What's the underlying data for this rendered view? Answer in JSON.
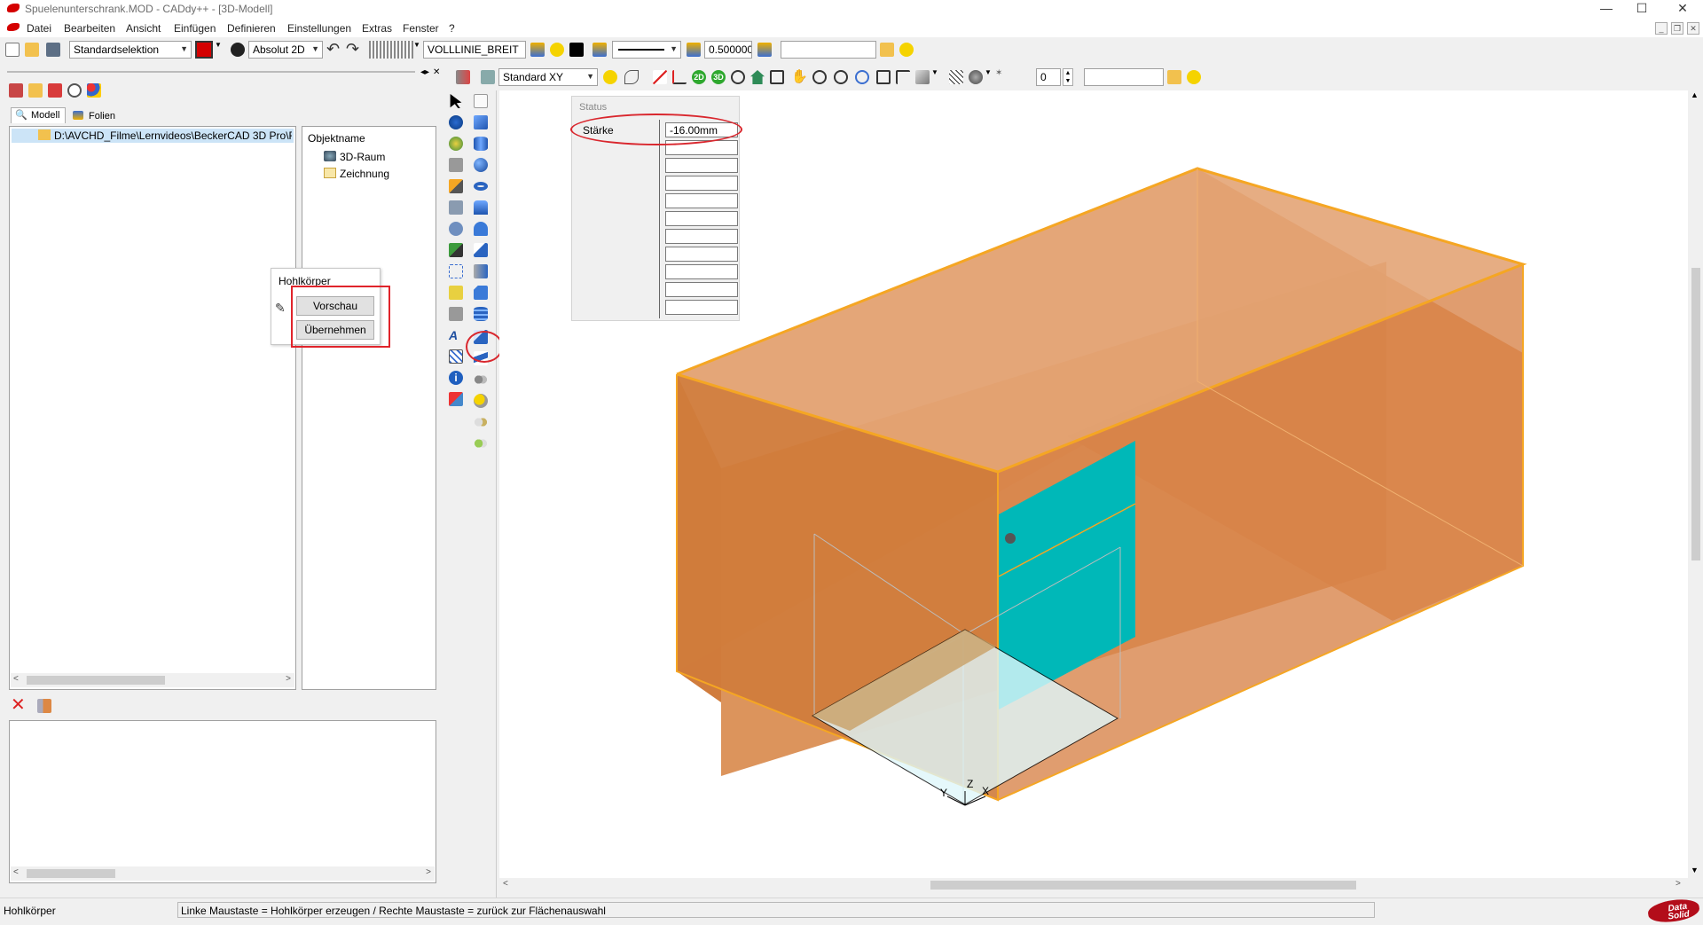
{
  "window": {
    "title": "Spuelenunterschrank.MOD  -  CADdy++ - [3D-Modell]",
    "controls": {
      "minimize": "—",
      "maximize": "☐",
      "close": "✕"
    }
  },
  "menu": [
    "Datei",
    "Bearbeiten",
    "Ansicht",
    "Einfügen",
    "Definieren",
    "Einstellungen",
    "Extras",
    "Fenster",
    "?"
  ],
  "toolbar": {
    "selection_mode": "Standardselektion",
    "coordinate_mode": "Absolut 2D",
    "line_type": "VOLLLINIE_BREIT",
    "line_width": "0.500000",
    "view": "Standard XY",
    "layer_number": "0",
    "accent_color": "#d40000"
  },
  "left_panel": {
    "tabs": [
      "Modell",
      "Folien"
    ],
    "path": "D:\\AVCHD_Filme\\Lernvideos\\BeckerCAD 3D Pro\\F",
    "object_header": "Objektname",
    "objects": [
      "3D-Raum",
      "Zeichnung"
    ]
  },
  "hohlkoerper_dialog": {
    "title": "Hohlkörper",
    "preview_button": "Vorschau",
    "apply_button": "Übernehmen"
  },
  "status_panel": {
    "title": "Status",
    "field_label": "Stärke",
    "field_value": "-16.00mm"
  },
  "axes": {
    "x": "X",
    "y": "Y",
    "z": "Z"
  },
  "statusbar": {
    "command": "Hohlkörper",
    "hint": "Linke Maustaste = Hohlkörper erzeugen / Rechte Maustaste = zurück zur Flächenauswahl",
    "brand": "Data Solid"
  },
  "colors": {
    "body_fill": "#d9884a",
    "body_edge": "#f5a623",
    "face_highlight": "#00b8b8",
    "annotation_red": "#e0242b"
  }
}
